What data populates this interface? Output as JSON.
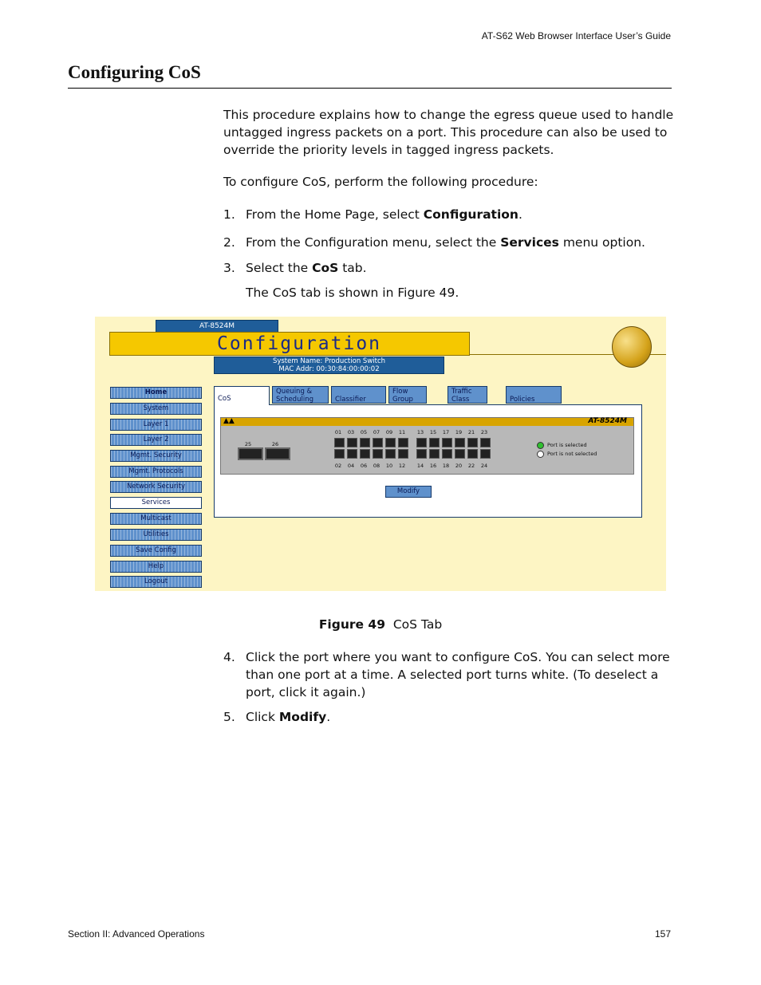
{
  "header": {
    "guide_title": "AT-S62 Web Browser Interface User’s Guide"
  },
  "section": {
    "title": "Configuring CoS"
  },
  "paragraphs": {
    "intro": "This procedure explains how to change the egress queue used to handle untagged ingress packets on a port. This procedure can also be used to override the priority levels in tagged ingress packets.",
    "lead": "To configure CoS, perform the following procedure:"
  },
  "steps": [
    {
      "num": "1.",
      "pre": "From the Home Page, select ",
      "bold": "Configuration",
      "post": "."
    },
    {
      "num": "2.",
      "pre": "From the Configuration menu, select the ",
      "bold": "Services",
      "post": " menu option."
    },
    {
      "num": "3.",
      "pre": "Select the ",
      "bold": "CoS",
      "post": " tab."
    },
    {
      "note": "The CoS tab is shown in Figure 49."
    },
    {
      "num": "4.",
      "pre": "Click the port where you want to configure CoS. You can select more than one port at a time. A selected port turns white. (To deselect a port, click it again.)",
      "bold": "",
      "post": ""
    },
    {
      "num": "5.",
      "pre": "Click ",
      "bold": "Modify",
      "post": "."
    }
  ],
  "figure": {
    "label": "Figure 49",
    "caption": "CoS Tab",
    "model_tab": "AT-8524M",
    "title_bar": "Configuration",
    "system_name": "System Name: Production Switch",
    "mac_addr": "MAC Addr: 00:30:84:00:00:02",
    "menu": [
      "Home",
      "System",
      "Layer 1",
      "Layer 2",
      "Mgmt. Security",
      "Mgmt. Protocols",
      "Network Security",
      "Services",
      "Multicast",
      "Utilities",
      "Save Config",
      "Help",
      "Logout"
    ],
    "menu_active": "Services",
    "tabs": [
      "CoS",
      "Queuing & Scheduling",
      "Classifier",
      "Flow Group",
      "Traffic Class",
      "Policies"
    ],
    "tab_active": "CoS",
    "switch_model": "AT-8524M",
    "sfp_labels": [
      "25",
      "26"
    ],
    "port_top_labels": [
      "01",
      "03",
      "05",
      "07",
      "09",
      "11",
      "13",
      "15",
      "17",
      "19",
      "21",
      "23"
    ],
    "port_bottom_labels": [
      "02",
      "04",
      "06",
      "08",
      "10",
      "12",
      "14",
      "16",
      "18",
      "20",
      "22",
      "24"
    ],
    "legend": [
      "Port is selected",
      "Port is not selected"
    ],
    "legend_colors": [
      "#2fbf2f",
      "#ffffff"
    ],
    "modify_button": "Modify"
  },
  "footer": {
    "section": "Section II: Advanced Operations",
    "page": "157"
  }
}
